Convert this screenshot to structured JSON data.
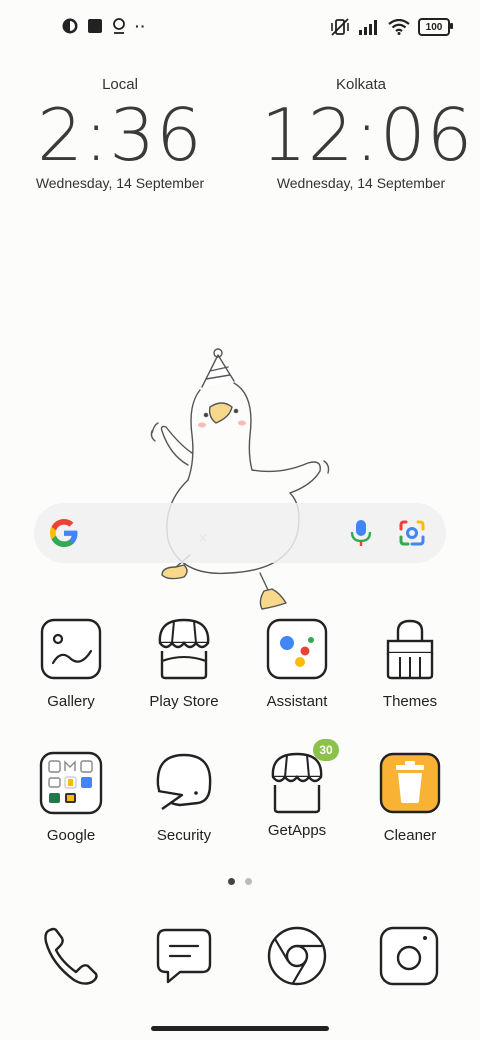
{
  "status_bar": {
    "battery": "100"
  },
  "clocks": [
    {
      "city": "Local",
      "time": "2:36",
      "date": "Wednesday, 14 September"
    },
    {
      "city": "Kolkata",
      "time": "12:06",
      "date": "Wednesday, 14 September"
    }
  ],
  "apps_row1": [
    {
      "label": "Gallery",
      "icon": "gallery-icon"
    },
    {
      "label": "Play Store",
      "icon": "play-store-icon"
    },
    {
      "label": "Assistant",
      "icon": "assistant-icon"
    },
    {
      "label": "Themes",
      "icon": "themes-icon"
    }
  ],
  "apps_row2": [
    {
      "label": "Google",
      "icon": "google-folder-icon"
    },
    {
      "label": "Security",
      "icon": "security-icon"
    },
    {
      "label": "GetApps",
      "icon": "getapps-icon",
      "badge": "30"
    },
    {
      "label": "Cleaner",
      "icon": "cleaner-icon"
    }
  ],
  "dock": [
    {
      "icon": "phone-icon"
    },
    {
      "icon": "messages-icon"
    },
    {
      "icon": "chrome-icon"
    },
    {
      "icon": "camera-icon"
    }
  ],
  "page_indicator": {
    "count": 2,
    "active": 0
  }
}
